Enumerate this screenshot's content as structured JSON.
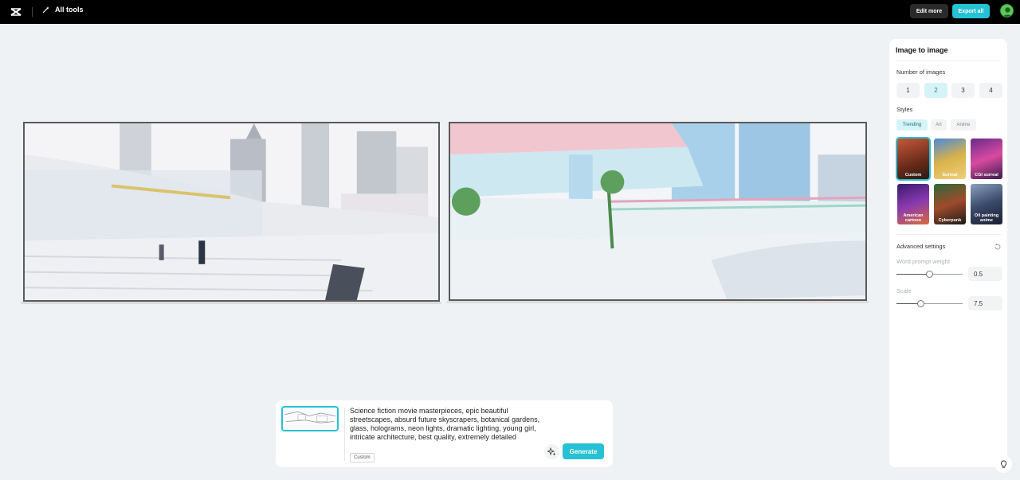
{
  "header": {
    "all_tools_label": "All tools",
    "edit_more_label": "Edit more",
    "export_all_label": "Export all"
  },
  "panel": {
    "title": "Image to image",
    "number_label": "Number of images",
    "number_options": [
      "1",
      "2",
      "3",
      "4"
    ],
    "number_selected": "2",
    "styles_label": "Styles",
    "style_tabs": [
      "Trending",
      "Art",
      "Anime"
    ],
    "style_tab_selected": "Trending",
    "styles": [
      {
        "label": "Custom",
        "selected": true
      },
      {
        "label": "Surreal",
        "selected": false
      },
      {
        "label": "CGI surreal",
        "selected": false
      },
      {
        "label": "American cartoon",
        "selected": false
      },
      {
        "label": "Cyberpunk",
        "selected": false
      },
      {
        "label": "Oil painting anime",
        "selected": false
      }
    ],
    "advanced_label": "Advanced settings",
    "word_prompt_label": "Word prompt weight",
    "word_prompt_value": "0.5",
    "word_prompt_fraction": 0.5,
    "scale_label": "Scale",
    "scale_value": "7.5",
    "scale_fraction": 0.37
  },
  "prompt": {
    "text": "Science fiction movie masterpieces, epic beautiful streetscapes, absurd future skyscrapers, botanical gardens, glass, holograms, neon lights, dramatic lighting, young girl, intricate architecture, best quality, extremely detailed",
    "tag": "Custom",
    "generate_label": "Generate"
  },
  "colors": {
    "accent": "#27c1d4",
    "topbar": "#000000",
    "canvas_bg": "#eef2f5"
  }
}
